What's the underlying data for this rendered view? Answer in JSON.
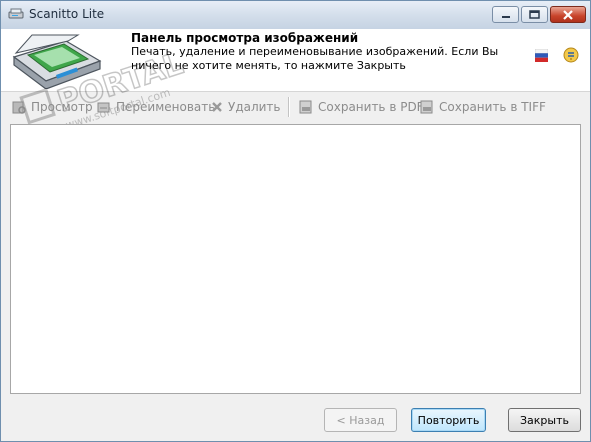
{
  "window": {
    "title": "Scanitto Lite"
  },
  "header": {
    "title": "Панель просмотра изображений",
    "description": "Печать, удаление и переименовывание изображений. Если Вы ничего не хотите менять, то нажмите Закрыть"
  },
  "watermark": {
    "line1": "PORTAL",
    "line2": "www.softportal.com"
  },
  "toolbar": {
    "view_label": "Просмотр",
    "rename_label": "Переименовать",
    "delete_label": "Удалить",
    "save_pdf_label": "Сохранить в PDF",
    "save_tiff_label": "Сохранить в TIFF"
  },
  "buttons": {
    "back_label": "< Назад",
    "retry_label": "Повторить",
    "close_label": "Закрыть"
  },
  "icons": {
    "app": "scanner-icon",
    "header": "flatbed-scanner-icon",
    "language": "russian-flag-icon",
    "help": "help-icon",
    "view": "view-icon",
    "rename": "rename-icon",
    "delete": "delete-icon",
    "pdf": "pdf-icon",
    "tiff": "tiff-icon"
  }
}
